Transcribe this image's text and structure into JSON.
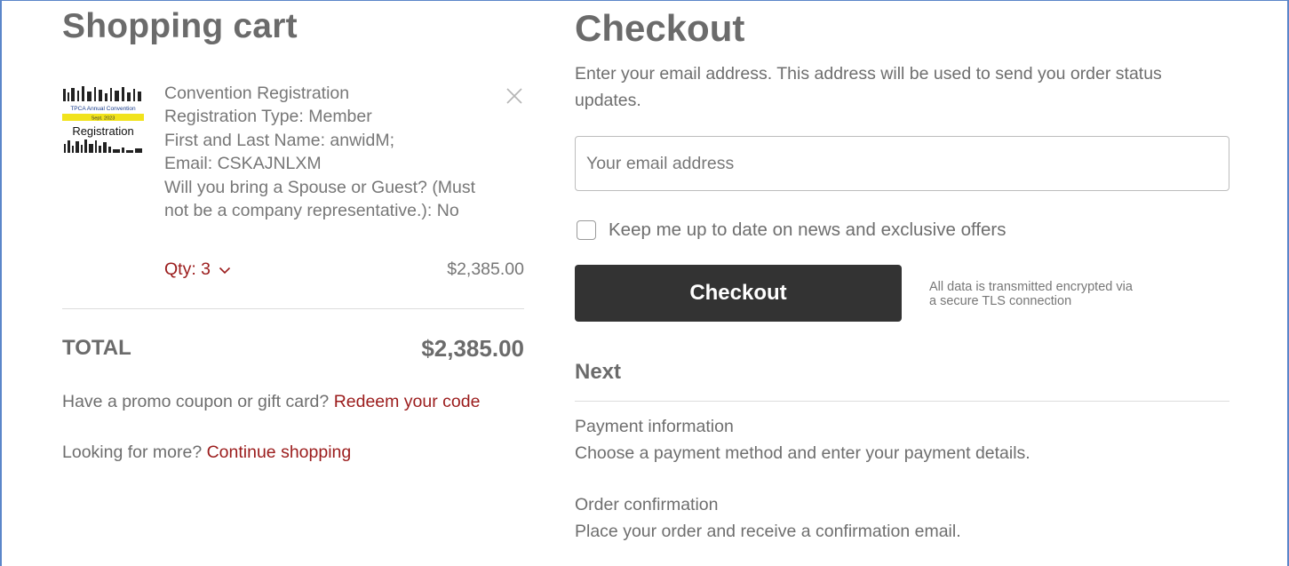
{
  "cart": {
    "title": "Shopping cart",
    "thumbnail": {
      "top_text": "TPCA Annual Convention",
      "ribbon_text": "Sept. 2023",
      "label": "Registration"
    },
    "item": {
      "name": "Convention Registration",
      "lines": [
        "Registration Type: Member",
        "First and Last Name: anwidM;",
        "Email: CSKAJNLXM",
        "Will you bring a Spouse or Guest? (Must",
        "not be a company representative.): No"
      ],
      "quantity": "Qty: 3",
      "price": "$2,385.00"
    },
    "total_label": "TOTAL",
    "total_value": "$2,385.00",
    "promo_text": "Have a promo coupon or gift card?",
    "promo_link": "Redeem your code",
    "more_text": "Looking for more?",
    "more_link": "Continue shopping"
  },
  "checkout": {
    "title": "Checkout",
    "instructions": "Enter your email address. This address will be used to send you order status updates.",
    "email_placeholder": "Your email address",
    "newsletter_label": "Keep me up to date on news and exclusive offers",
    "button_label": "Checkout",
    "secure_note_line1": "All data is transmitted encrypted via",
    "secure_note_line2": "a secure TLS connection",
    "next_title": "Next",
    "steps": [
      {
        "title": "Payment information",
        "description": "Choose a payment method and enter your payment details."
      },
      {
        "title": "Order confirmation",
        "description": "Place your order and receive a confirmation email."
      }
    ]
  },
  "colors": {
    "link": "#9b1c1c",
    "button_bg": "#333333",
    "frame": "#5b86c9"
  },
  "icons": {
    "remove": "close-icon",
    "quantity_dropdown": "chevron-down-icon"
  }
}
